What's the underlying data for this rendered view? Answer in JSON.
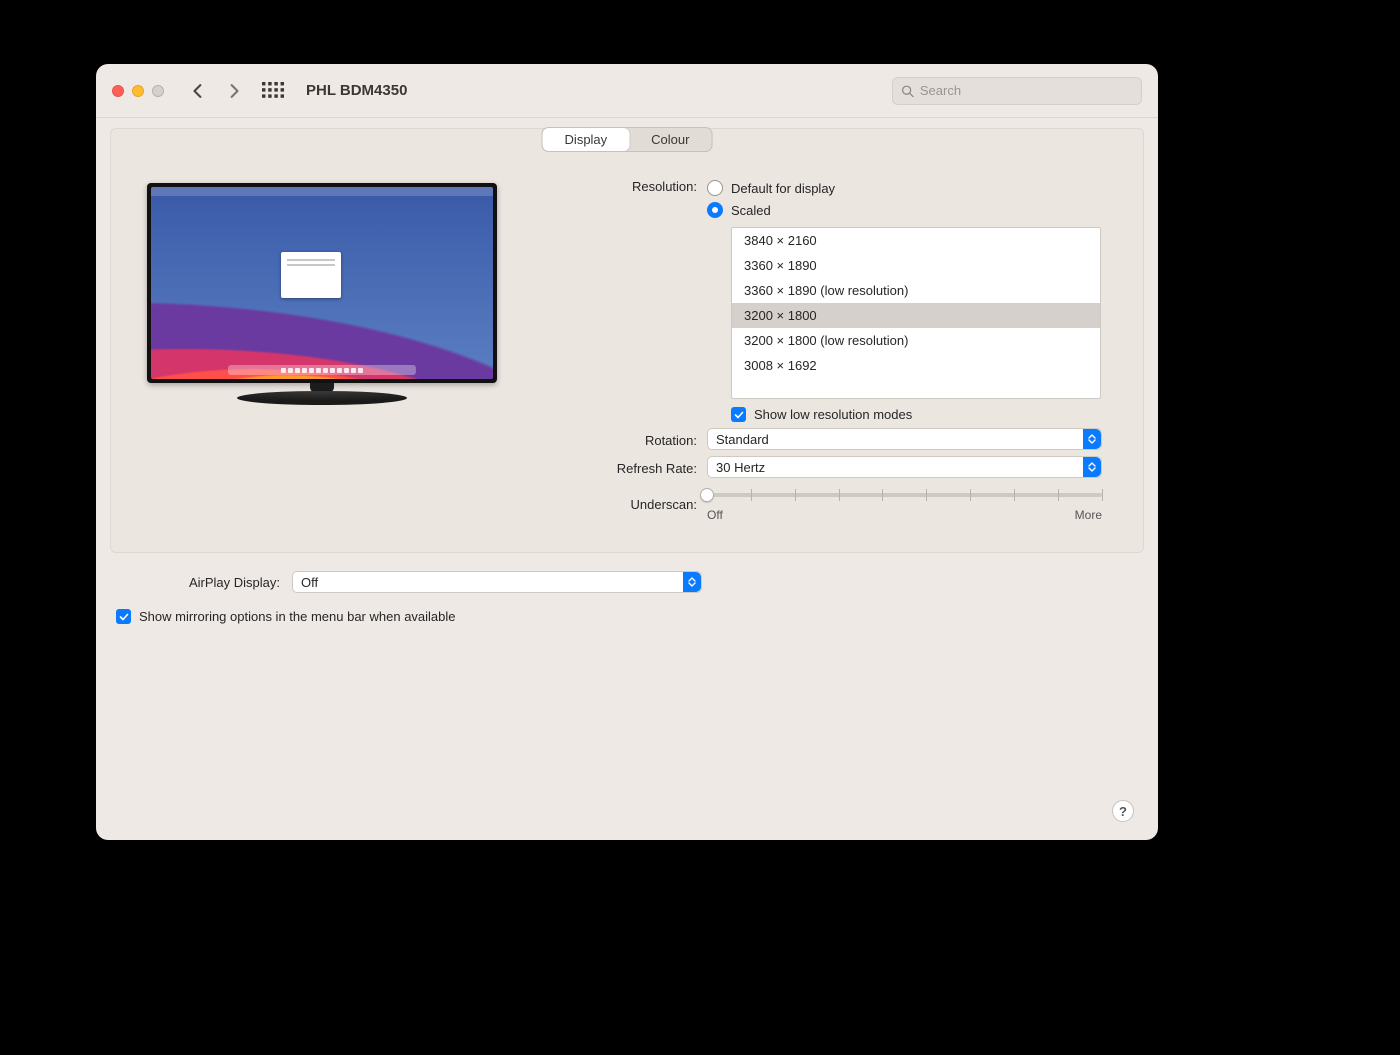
{
  "window": {
    "title": "PHL BDM4350"
  },
  "search": {
    "placeholder": "Search"
  },
  "tabs": {
    "display": "Display",
    "colour": "Colour"
  },
  "resolution": {
    "label": "Resolution:",
    "default_label": "Default for display",
    "scaled_label": "Scaled",
    "options": [
      "3840 × 2160",
      "3360 × 1890",
      "3360 × 1890 (low resolution)",
      "3200 × 1800",
      "3200 × 1800 (low resolution)",
      "3008 × 1692"
    ],
    "selected_index": 3,
    "show_low_res_label": "Show low resolution modes"
  },
  "rotation": {
    "label": "Rotation:",
    "value": "Standard"
  },
  "refresh_rate": {
    "label": "Refresh Rate:",
    "value": "30 Hertz"
  },
  "underscan": {
    "label": "Underscan:",
    "min_label": "Off",
    "max_label": "More"
  },
  "airplay": {
    "label": "AirPlay Display:",
    "value": "Off"
  },
  "mirroring": {
    "label": "Show mirroring options in the menu bar when available"
  },
  "help": {
    "symbol": "?"
  }
}
